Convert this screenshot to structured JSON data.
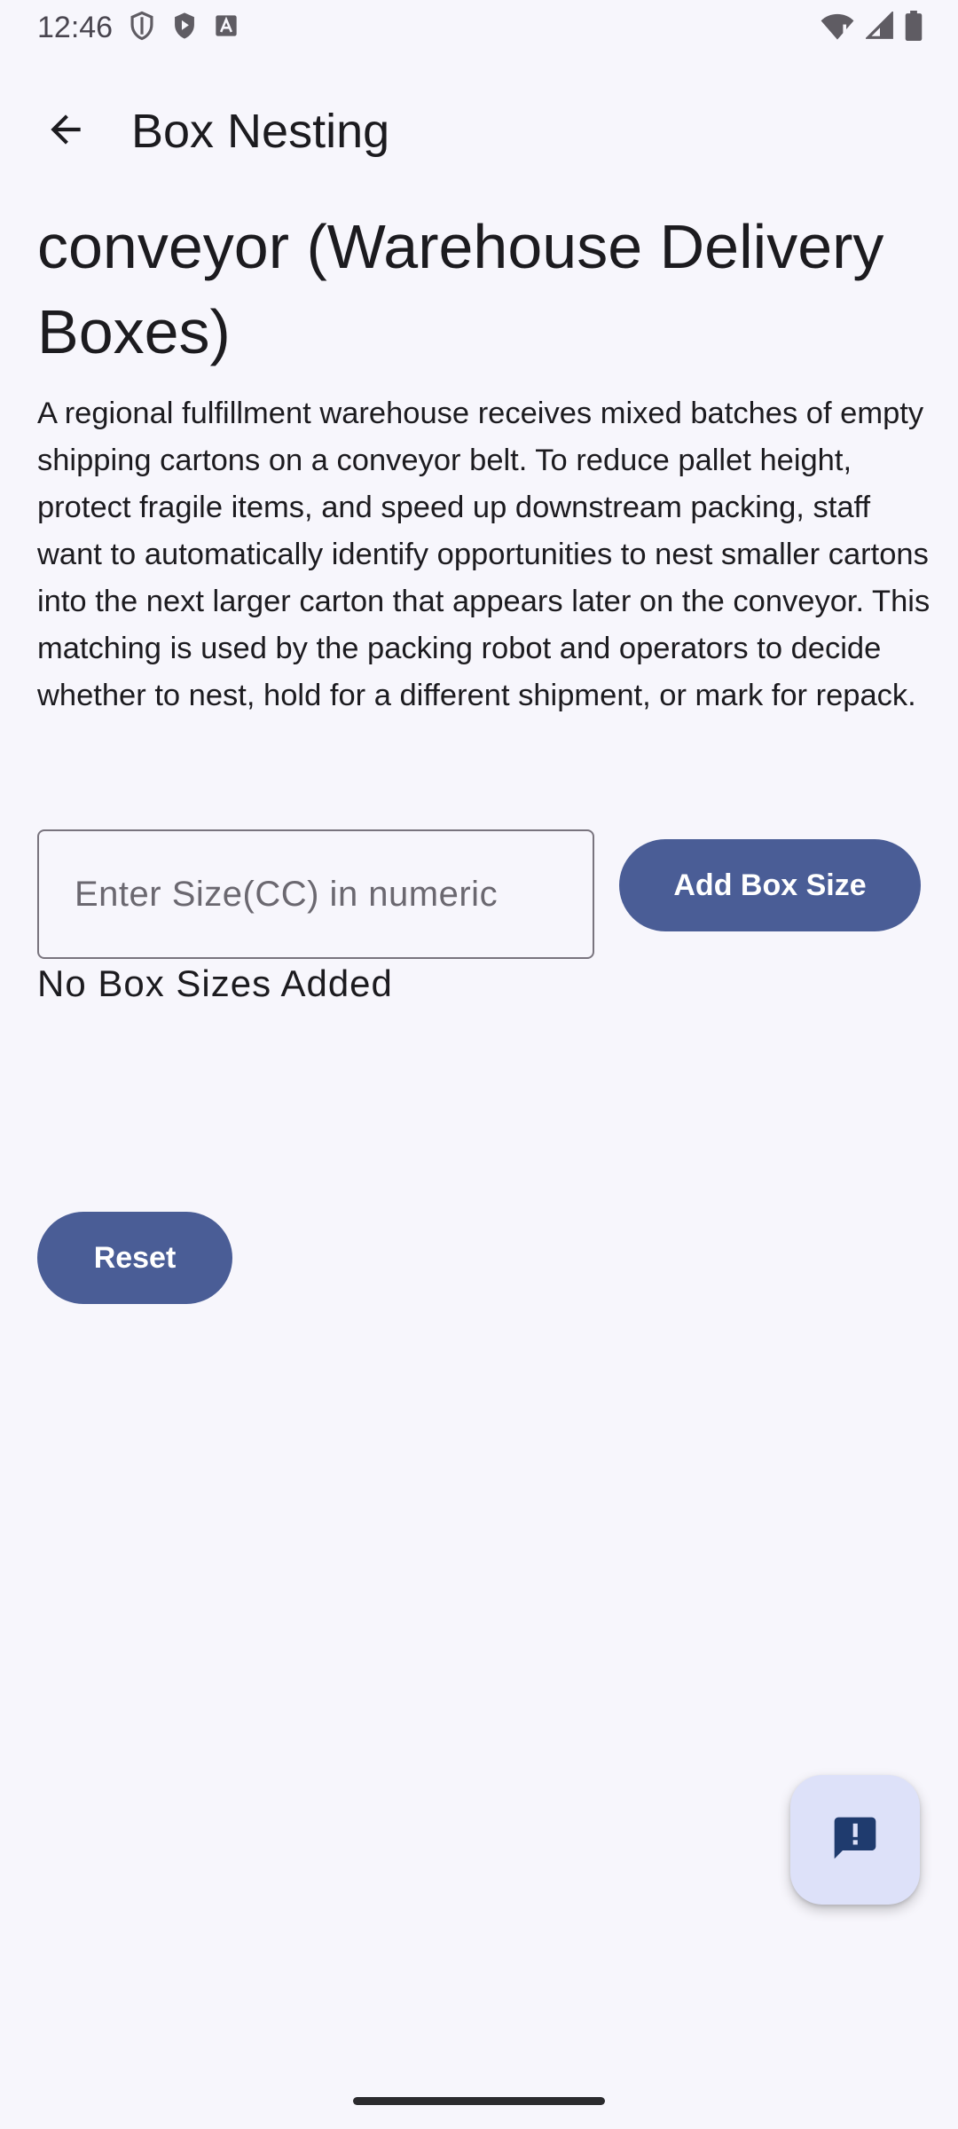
{
  "status_bar": {
    "time": "12:46",
    "icons_left": [
      "shield-outline-icon",
      "shield-play-icon",
      "font-a-icon"
    ],
    "icons_right": [
      "wifi-alert-icon",
      "cell-signal-icon",
      "battery-icon"
    ]
  },
  "app_bar": {
    "back_icon": "arrow-back-icon",
    "title": "Box Nesting"
  },
  "main": {
    "heading": "conveyor (Warehouse Delivery Boxes)",
    "description": "A regional fulfillment warehouse receives mixed batches of empty shipping cartons on a conveyor belt. To reduce pallet height, protect fragile items, and speed up downstream packing, staff want to automatically identify opportunities to nest smaller cartons into the next larger carton that appears later on the conveyor. This matching is used by the packing robot and operators to decide whether to nest, hold for a different shipment, or mark for repack.",
    "size_input": {
      "value": "",
      "placeholder": "Enter Size(CC) in numeric"
    },
    "add_button_label": "Add Box Size",
    "empty_state": "No Box Sizes Added",
    "reset_button_label": "Reset"
  },
  "fab": {
    "icon": "feedback-icon"
  },
  "colors": {
    "background": "#f7f6fc",
    "primary_button": "#4a5d96",
    "fab_background": "#dde1f9",
    "fab_icon": "#1f3b6e"
  }
}
